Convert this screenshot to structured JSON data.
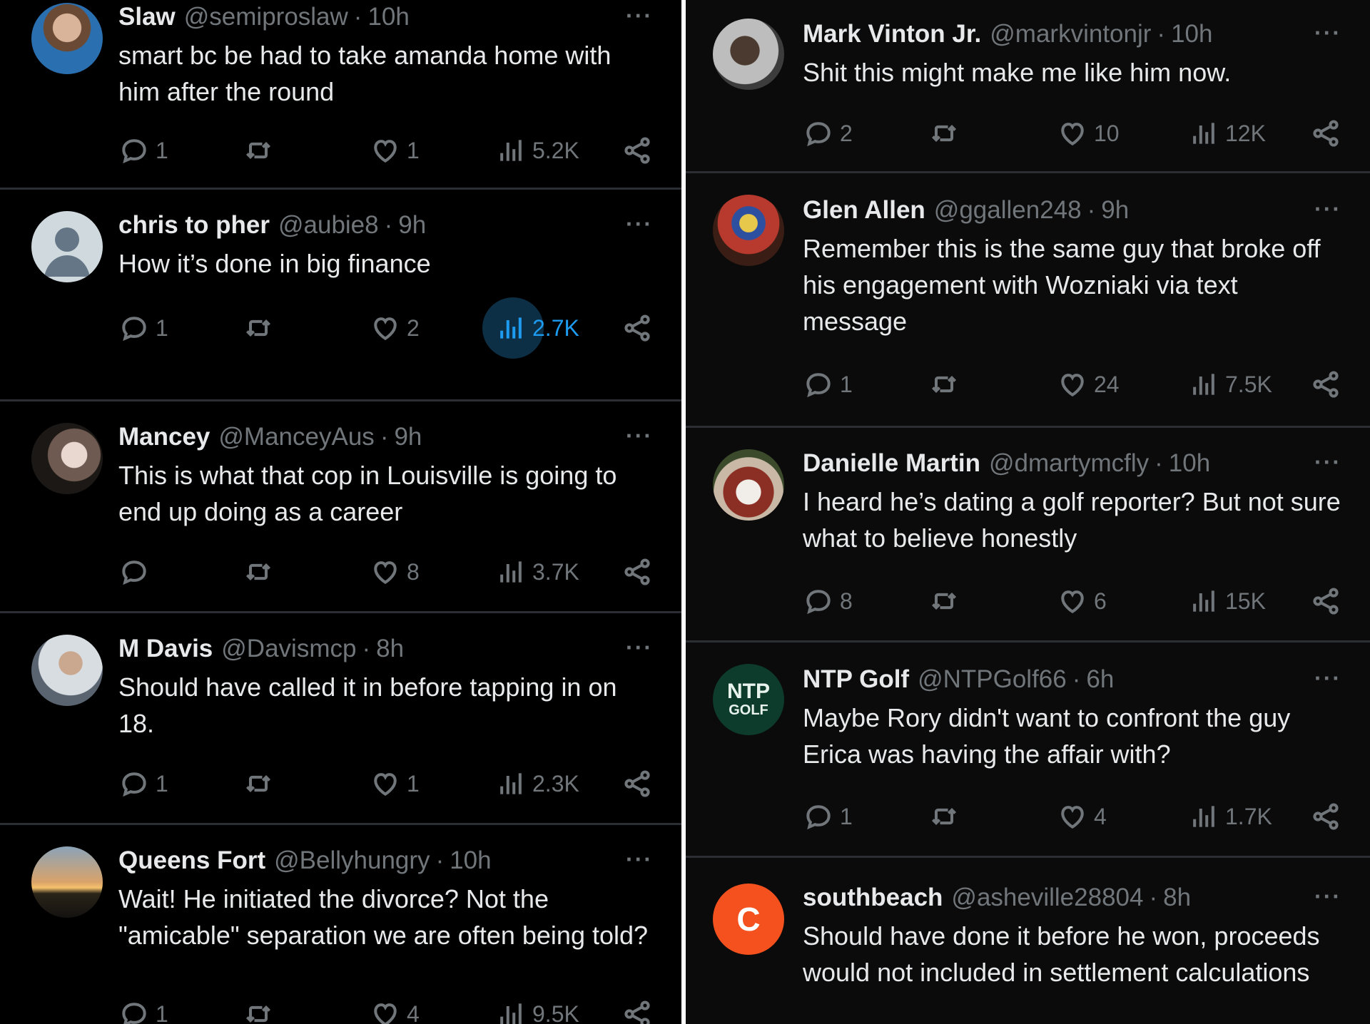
{
  "left_column": {
    "tweets": [
      {
        "name": "Slaw",
        "handle": "@semiproslaw",
        "time": "10h",
        "text": "smart bc be had to take amanda home with him after the round",
        "replies": "1",
        "retweets": "",
        "likes": "1",
        "views": "5.2K"
      },
      {
        "name": "chris to pher",
        "handle": "@aubie8",
        "time": "9h",
        "text": "How it’s done in big finance",
        "replies": "1",
        "retweets": "",
        "likes": "2",
        "views": "2.7K"
      },
      {
        "name": "Mancey",
        "handle": "@ManceyAus",
        "time": "9h",
        "text": "This is what that cop in Louisville is going to end up doing as a career",
        "replies": "",
        "retweets": "",
        "likes": "8",
        "views": "3.7K"
      },
      {
        "name": "M Davis",
        "handle": "@Davismcp",
        "time": "8h",
        "text": "Should have called it in before tapping in on 18.",
        "replies": "1",
        "retweets": "",
        "likes": "1",
        "views": "2.3K"
      },
      {
        "name": "Queens Fort",
        "handle": "@Bellyhungry",
        "time": "10h",
        "text": "Wait! He initiated the divorce? Not the \"amicable\" separation we are often being told?",
        "replies": "1",
        "retweets": "",
        "likes": "4",
        "views": "9.5K"
      }
    ]
  },
  "right_column": {
    "tweets": [
      {
        "name": "Mark Vinton Jr.",
        "handle": "@markvintonjr",
        "time": "10h",
        "text": "Shit this might make me like him now.",
        "replies": "2",
        "retweets": "",
        "likes": "10",
        "views": "12K"
      },
      {
        "name": "Glen Allen",
        "handle": "@ggallen248",
        "time": "9h",
        "text": "Remember this is the same guy that broke off his engagement with Wozniaki via text message",
        "replies": "1",
        "retweets": "",
        "likes": "24",
        "views": "7.5K"
      },
      {
        "name": "Danielle Martin",
        "handle": "@dmartymcfly",
        "time": "10h",
        "text": "I heard he’s dating a golf reporter? But not sure what to believe honestly",
        "replies": "8",
        "retweets": "",
        "likes": "6",
        "views": "15K"
      },
      {
        "name": "NTP Golf",
        "handle": "@NTPGolf66",
        "time": "6h",
        "text": "Maybe Rory didn't want to confront the guy Erica was having the affair with?",
        "replies": "1",
        "retweets": "",
        "likes": "4",
        "views": "1.7K"
      },
      {
        "name": "southbeach",
        "handle": "@asheville28804",
        "time": "8h",
        "text": "Should have done it before he won, proceeds would not included in settlement calculations",
        "replies": "",
        "retweets": "",
        "likes": "",
        "views": ""
      }
    ]
  },
  "separator": "·",
  "more_glyph": "···",
  "avatar_letters": {
    "southbeach": "C"
  },
  "ntp_logo": {
    "line1": "NTP",
    "line2": "GOLF"
  },
  "colors": {
    "background": "#000000",
    "text": "#e7e9ea",
    "muted": "#71767b",
    "accent": "#1d9bf0",
    "divider": "#2b2f33"
  }
}
